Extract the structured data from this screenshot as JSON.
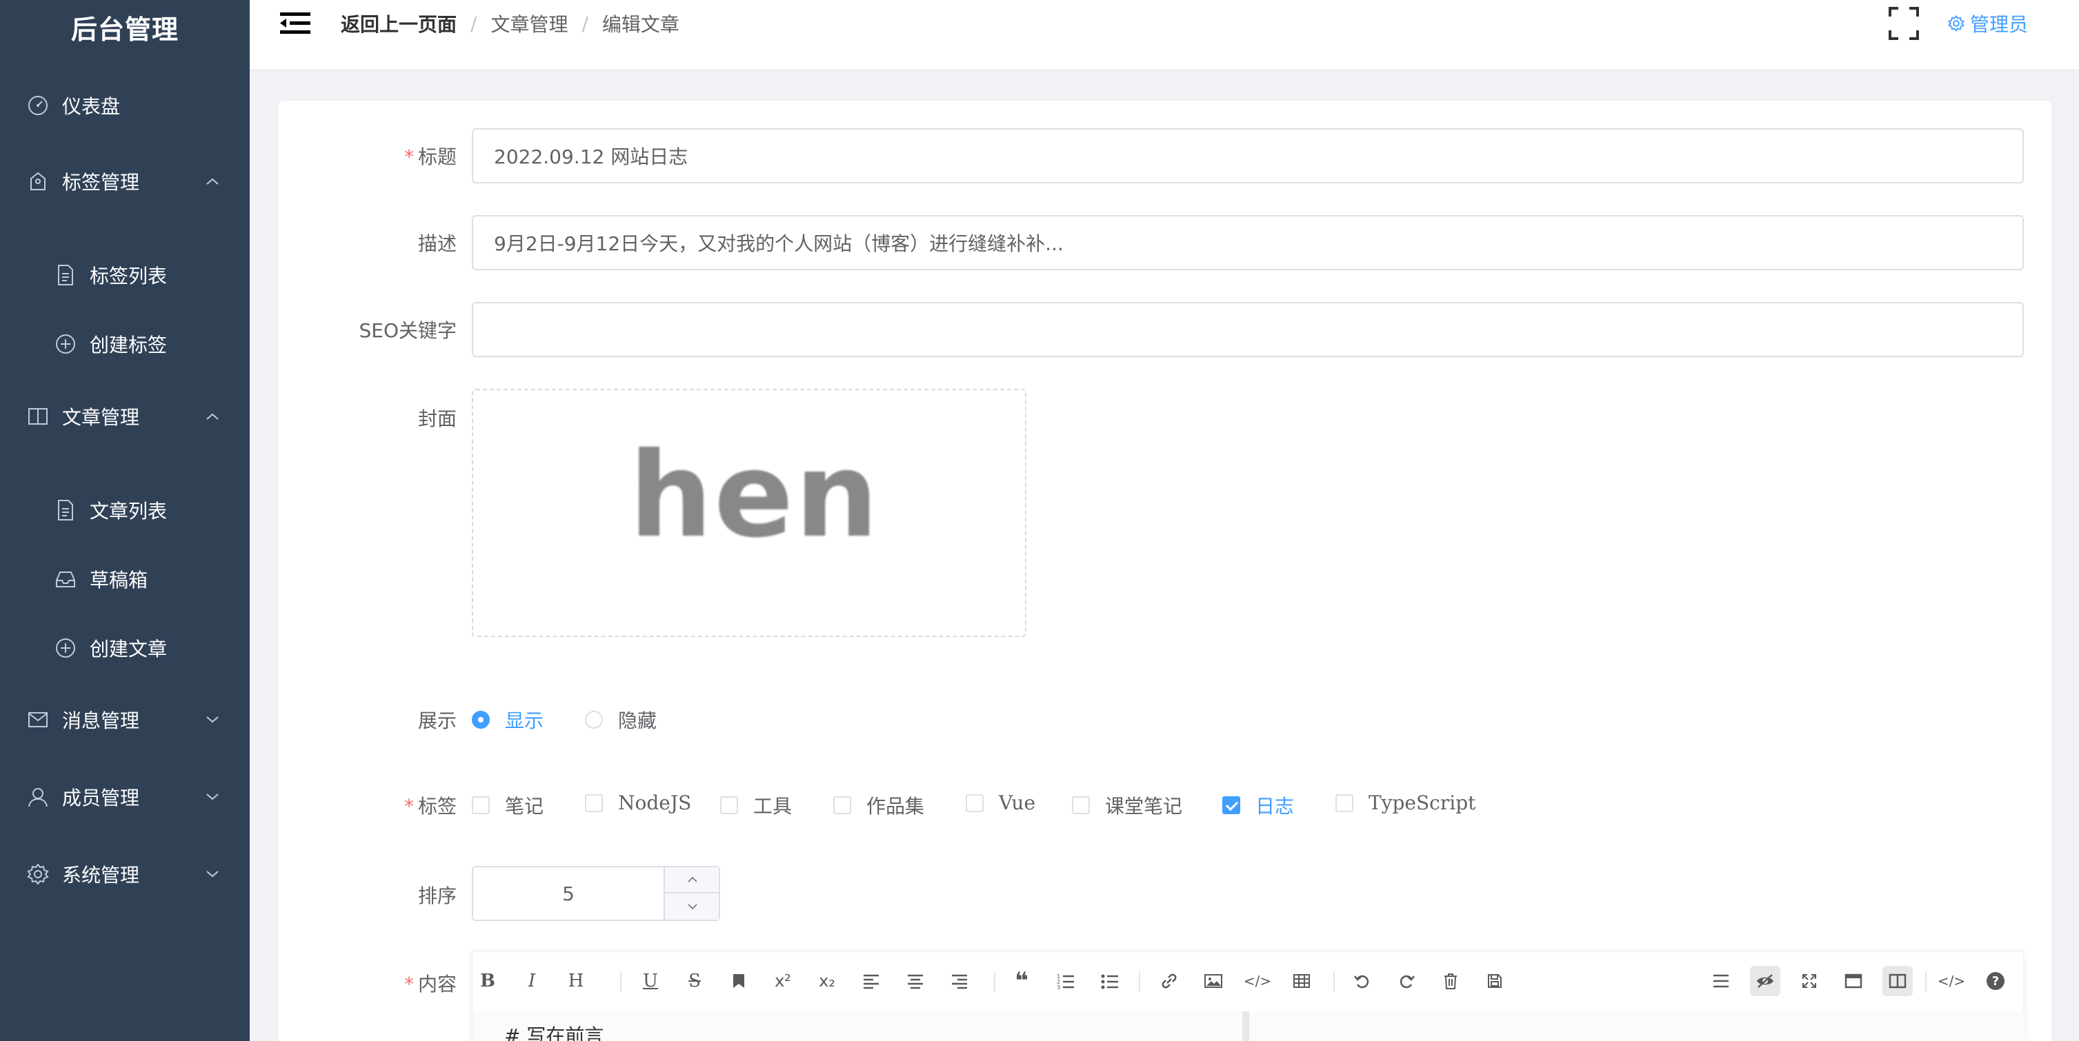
{
  "sidebar": {
    "logo": "后台管理",
    "items": [
      {
        "label": "仪表盘",
        "icon": "dashboard-icon"
      },
      {
        "label": "标签管理",
        "icon": "tag-icon",
        "expanded": true
      },
      {
        "label": "标签列表",
        "icon": "document-icon"
      },
      {
        "label": "创建标签",
        "icon": "plus-circle-icon"
      },
      {
        "label": "文章管理",
        "icon": "book-icon",
        "expanded": true
      },
      {
        "label": "文章列表",
        "icon": "document-icon"
      },
      {
        "label": "草稿箱",
        "icon": "inbox-icon"
      },
      {
        "label": "创建文章",
        "icon": "plus-circle-icon"
      },
      {
        "label": "消息管理",
        "icon": "message-icon",
        "expanded": false
      },
      {
        "label": "成员管理",
        "icon": "user-icon",
        "expanded": false
      },
      {
        "label": "系统管理",
        "icon": "gear-icon",
        "expanded": false
      }
    ]
  },
  "header": {
    "breadcrumb": [
      "返回上一页面",
      "文章管理",
      "编辑文章"
    ],
    "separator": "/",
    "admin_label": "管理员"
  },
  "form": {
    "title": {
      "label": "标题",
      "value": "2022.09.12 网站日志",
      "required": true
    },
    "desc": {
      "label": "描述",
      "value": "9月2日-9月12日今天，又对我的个人网站（博客）进行缝缝补补..."
    },
    "seo": {
      "label": "SEO关键字",
      "value": ""
    },
    "cover": {
      "label": "封面",
      "image_text": "hen"
    },
    "display": {
      "label": "展示",
      "options": [
        "显示",
        "隐藏"
      ],
      "selected": "显示"
    },
    "tags": {
      "label": "标签",
      "required": true,
      "options": [
        "笔记",
        "NodeJS",
        "工具",
        "作品集",
        "Vue",
        "课堂笔记",
        "日志",
        "TypeScript"
      ],
      "checked": [
        "日志"
      ]
    },
    "sort": {
      "label": "排序",
      "value": "5"
    },
    "content": {
      "label": "内容",
      "required": true,
      "first_line": "#  写在前言"
    }
  },
  "colors": {
    "sidebar_bg": "#304156",
    "accent": "#409eff",
    "required": "#f56c6c"
  }
}
